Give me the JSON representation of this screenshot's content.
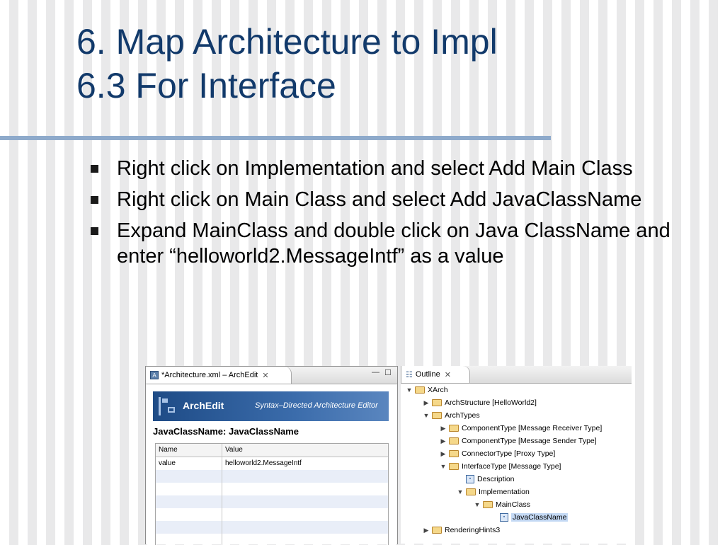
{
  "slide": {
    "title_line1": "6. Map Architecture to Impl",
    "title_line2": "6.3 For Interface",
    "bullets": [
      "Right click on Implementation and select Add Main Class",
      "Right click on Main Class and select Add JavaClassName",
      "Expand MainClass and double click on Java ClassName and enter “helloworld2.MessageIntf” as a value"
    ]
  },
  "archedit": {
    "tab_title": "*Architecture.xml – ArchEdit",
    "banner_brand": "ArchEdit",
    "banner_subtitle": "Syntax–Directed Architecture Editor",
    "heading": "JavaClassName: JavaClassName",
    "columns": [
      "Name",
      "Value"
    ],
    "rows": [
      [
        "value",
        "helloworld2.MessageIntf"
      ]
    ]
  },
  "outline": {
    "tab_title": "Outline",
    "nodes": [
      {
        "label": "XArch",
        "depth": 0,
        "toggle": "▼",
        "kind": "folder"
      },
      {
        "label": "ArchStructure [HelloWorld2]",
        "depth": 1,
        "toggle": "▶",
        "kind": "folder"
      },
      {
        "label": "ArchTypes",
        "depth": 1,
        "toggle": "▼",
        "kind": "folder"
      },
      {
        "label": "ComponentType [Message Receiver Type]",
        "depth": 2,
        "toggle": "▶",
        "kind": "folder"
      },
      {
        "label": "ComponentType [Message Sender Type]",
        "depth": 2,
        "toggle": "▶",
        "kind": "folder"
      },
      {
        "label": "ConnectorType [Proxy Type]",
        "depth": 2,
        "toggle": "▶",
        "kind": "folder"
      },
      {
        "label": "InterfaceType [Message Type]",
        "depth": 2,
        "toggle": "▼",
        "kind": "folder"
      },
      {
        "label": "Description",
        "depth": 3,
        "toggle": "",
        "kind": "leaf"
      },
      {
        "label": "Implementation",
        "depth": 3,
        "toggle": "▼",
        "kind": "folder"
      },
      {
        "label": "MainClass",
        "depth": 4,
        "toggle": "▼",
        "kind": "folder"
      },
      {
        "label": "JavaClassName",
        "depth": 5,
        "toggle": "",
        "kind": "leaf",
        "selected": true
      },
      {
        "label": "RenderingHints3",
        "depth": 1,
        "toggle": "▶",
        "kind": "folder"
      }
    ]
  }
}
